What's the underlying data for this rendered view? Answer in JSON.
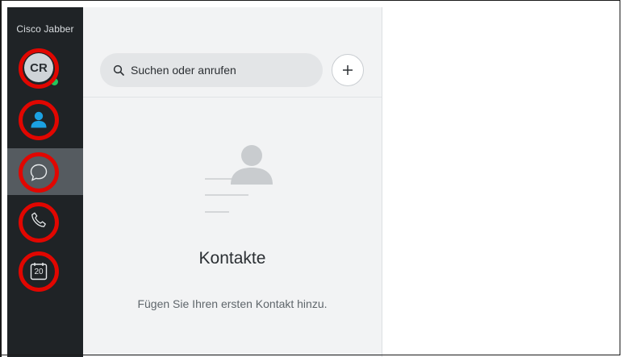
{
  "app": {
    "title": "Cisco Jabber"
  },
  "user": {
    "initials": "CR",
    "presence_color": "#22c55e"
  },
  "sidebar": {
    "items": [
      {
        "name": "avatar",
        "icon": "avatar",
        "number": "1"
      },
      {
        "name": "contacts",
        "icon": "person-icon",
        "number": "2"
      },
      {
        "name": "chats",
        "icon": "chat-bubble-icon",
        "number": "3"
      },
      {
        "name": "calls",
        "icon": "phone-icon",
        "number": "4"
      },
      {
        "name": "meetings",
        "icon": "calendar-icon",
        "number": "5",
        "calendar_day": "20"
      }
    ]
  },
  "search": {
    "placeholder": "Suchen oder anrufen",
    "icon": "search-icon"
  },
  "add_button": {
    "icon": "plus-icon"
  },
  "empty_state": {
    "icon": "contacts-illustration-icon",
    "title": "Kontakte",
    "subtitle": "Fügen Sie Ihren ersten Kontakt hinzu."
  },
  "colors": {
    "sidebar_bg": "#1f2326",
    "active_item_bg": "#555b60",
    "annotation_red": "#e10600",
    "contacts_icon_blue": "#1ba1e2",
    "panel_bg": "#f2f3f4"
  }
}
